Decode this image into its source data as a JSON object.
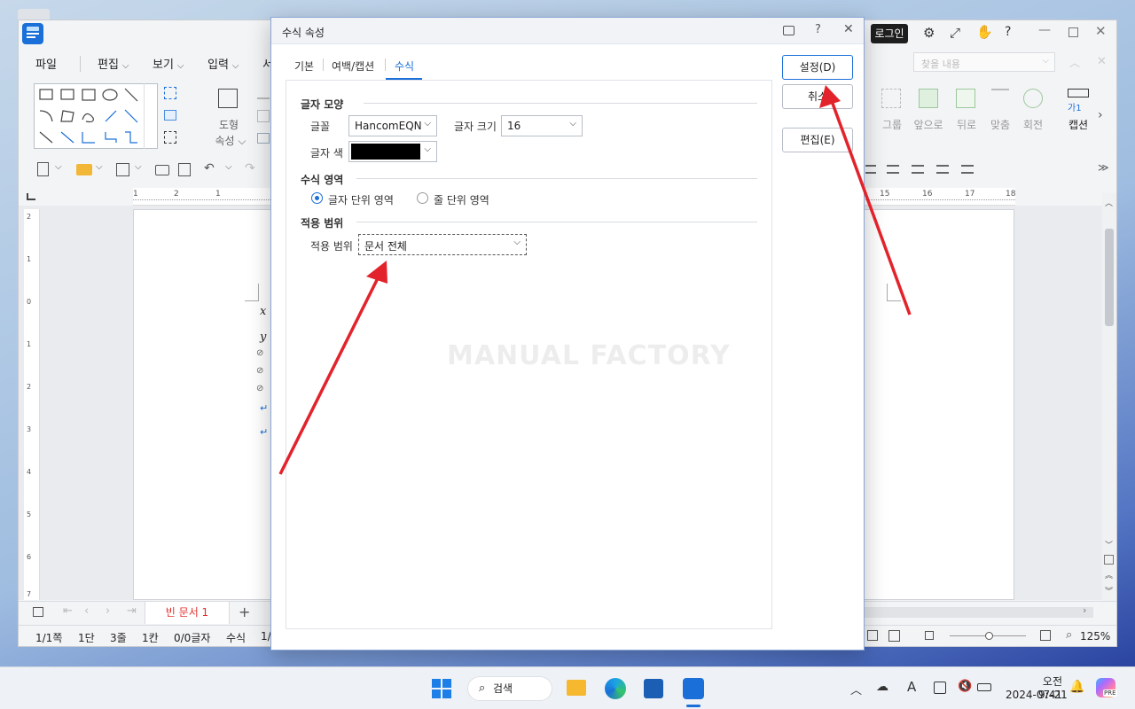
{
  "app": {
    "login_label": "로그인",
    "menus": [
      "파일",
      "편집",
      "보기",
      "입력",
      "서"
    ],
    "toolbar": {
      "shape_label": "도형",
      "shape_prop_label": "속성",
      "group_label": "그룹",
      "front_label": "앞으로",
      "back_label": "뒤로",
      "fit_label": "맞춤",
      "rotate_label": "회전",
      "caption_label": "캡션",
      "caption_icon_text": "가1",
      "search_placeholder": "찾을 내용"
    },
    "ruler_ticks_left": [
      "1",
      "2",
      "1"
    ],
    "ruler_ticks_right": [
      "15",
      "16",
      "17",
      "18"
    ],
    "vruler_ticks": [
      "2",
      "1",
      "0",
      "1",
      "2",
      "3",
      "4",
      "5",
      "6",
      "7"
    ],
    "doc_symbols": [
      "x",
      "y",
      "⊘",
      "⊘",
      "⊘",
      "↵",
      "↵"
    ],
    "tab_name": "빈 문서 1",
    "status": {
      "page": "1/1쪽",
      "section": "1단",
      "line": "3줄",
      "column": "1칸",
      "chars": "0/0글자",
      "mode": "수식",
      "page_short": "1/",
      "zoom": "125%"
    }
  },
  "dialog": {
    "title": "수식 속성",
    "tabs": [
      "기본",
      "여백/캡션",
      "수식"
    ],
    "active_tab": 2,
    "sections": {
      "shape": "글자 모양",
      "area": "수식 영역",
      "scope": "적용 범위"
    },
    "font_label": "글꼴",
    "font_value": "HancomEQN",
    "size_label": "글자 크기",
    "size_value": "16",
    "color_label": "글자 색",
    "color_value": "#000000",
    "radio_char": "글자 단위 영역",
    "radio_line": "줄 단위 영역",
    "radio_selected": "char",
    "scope_label": "적용 범위",
    "scope_value": "문서 전체",
    "watermark": "MANUAL FACTORY",
    "buttons": {
      "ok": "설정(D)",
      "cancel": "취소",
      "edit": "편집(E)"
    }
  },
  "taskbar": {
    "search_label": "검색",
    "time": "오전 9:41",
    "date": "2024-07-21",
    "ime": "A",
    "copilot_badge": "PRE"
  },
  "colors": {
    "accent": "#1a6fd9",
    "arrow": "#e3232b",
    "tab_active_text": "#e2322f"
  }
}
